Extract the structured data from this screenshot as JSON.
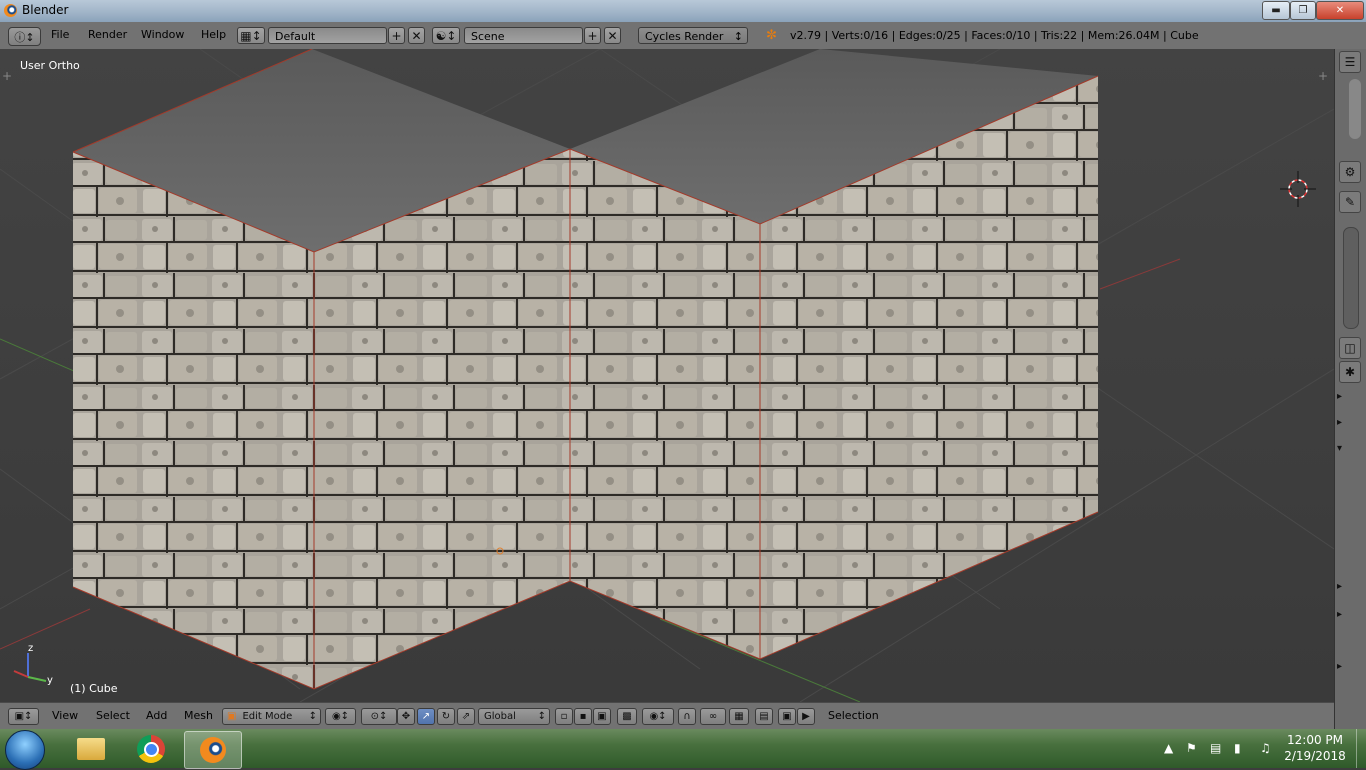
{
  "window": {
    "title": "Blender"
  },
  "menu": [
    "File",
    "Render",
    "Window",
    "Help"
  ],
  "screen_layout": "Default",
  "scene": "Scene",
  "render_engine": "Cycles Render",
  "stats": "v2.79 | Verts:0/16 | Edges:0/25 | Faces:0/10 | Tris:22 | Mem:26.04M | Cube",
  "viewport": {
    "view_label": "User Ortho",
    "object_label": "(1) Cube",
    "axis_z": "z",
    "axis_y": "y"
  },
  "bottom": {
    "menus": [
      "View",
      "Select",
      "Add",
      "Mesh"
    ],
    "mode": "Edit Mode",
    "orientation": "Global",
    "selection_label": "Selection"
  },
  "taskbar": {
    "time": "12:00 PM",
    "date": "2/19/2018"
  },
  "colors": {
    "accent": "#5173ad",
    "header": "#727272",
    "viewport": "#3d3d3d",
    "stone": "#a6a198"
  },
  "icons": [
    "blender-icon",
    "info-icon",
    "layout-icon",
    "scene-icon",
    "render-icon",
    "cursor-3d-icon",
    "windows-start-icon",
    "folder-icon",
    "chrome-icon"
  ]
}
